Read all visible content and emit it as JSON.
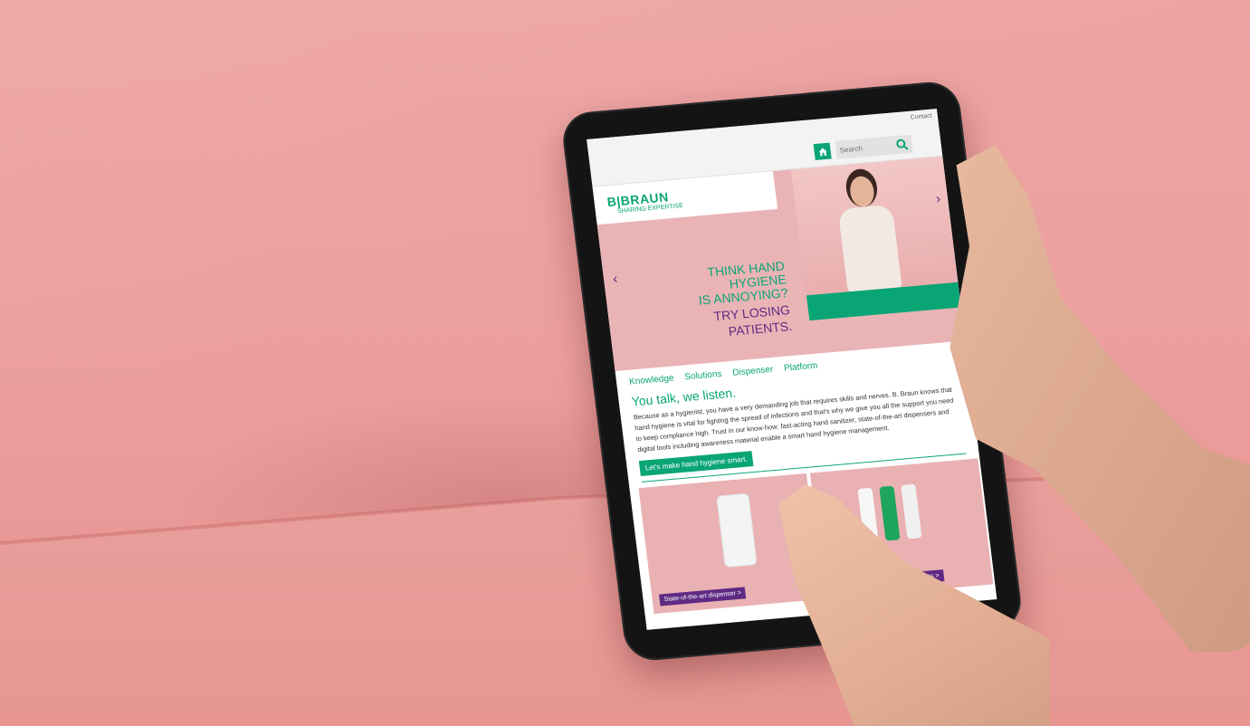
{
  "site": {
    "contact_label": "Contact",
    "search_placeholder": "Search",
    "logo_main": "B|BRAUN",
    "logo_sub": "SHARING EXPERTISE"
  },
  "hero": {
    "headline_line1": "THINK HAND HYGIENE",
    "headline_line2": "IS ANNOYING?",
    "headline_line3": "TRY LOSING PATIENTS.",
    "prev_arrow": "‹",
    "next_arrow": "›"
  },
  "tabs": [
    "Knowledge",
    "Solutions",
    "Dispenser",
    "Platform"
  ],
  "content": {
    "title": "You talk, we listen.",
    "body": "Because as a hygienist, you have a very demanding job that requires skills and nerves. B. Braun knows that hand hygiene is vital for fighting the spread of infections and that's why we give you all the support you need to keep compliance high. Trust in our know-how: fast-acting hand sanitizer, state-of-the-art dispensers and digital tools including awareness material enable a smart hand hygiene management.",
    "cta_label": "Let's make hand hygiene smart."
  },
  "cards": [
    {
      "label": "State-of-the-art dispenser >"
    },
    {
      "label": "Hand hygiene solutions >"
    }
  ],
  "colors": {
    "brand_green": "#0aa575",
    "brand_purple": "#5e2a84",
    "background_pink": "#eda5a4"
  }
}
